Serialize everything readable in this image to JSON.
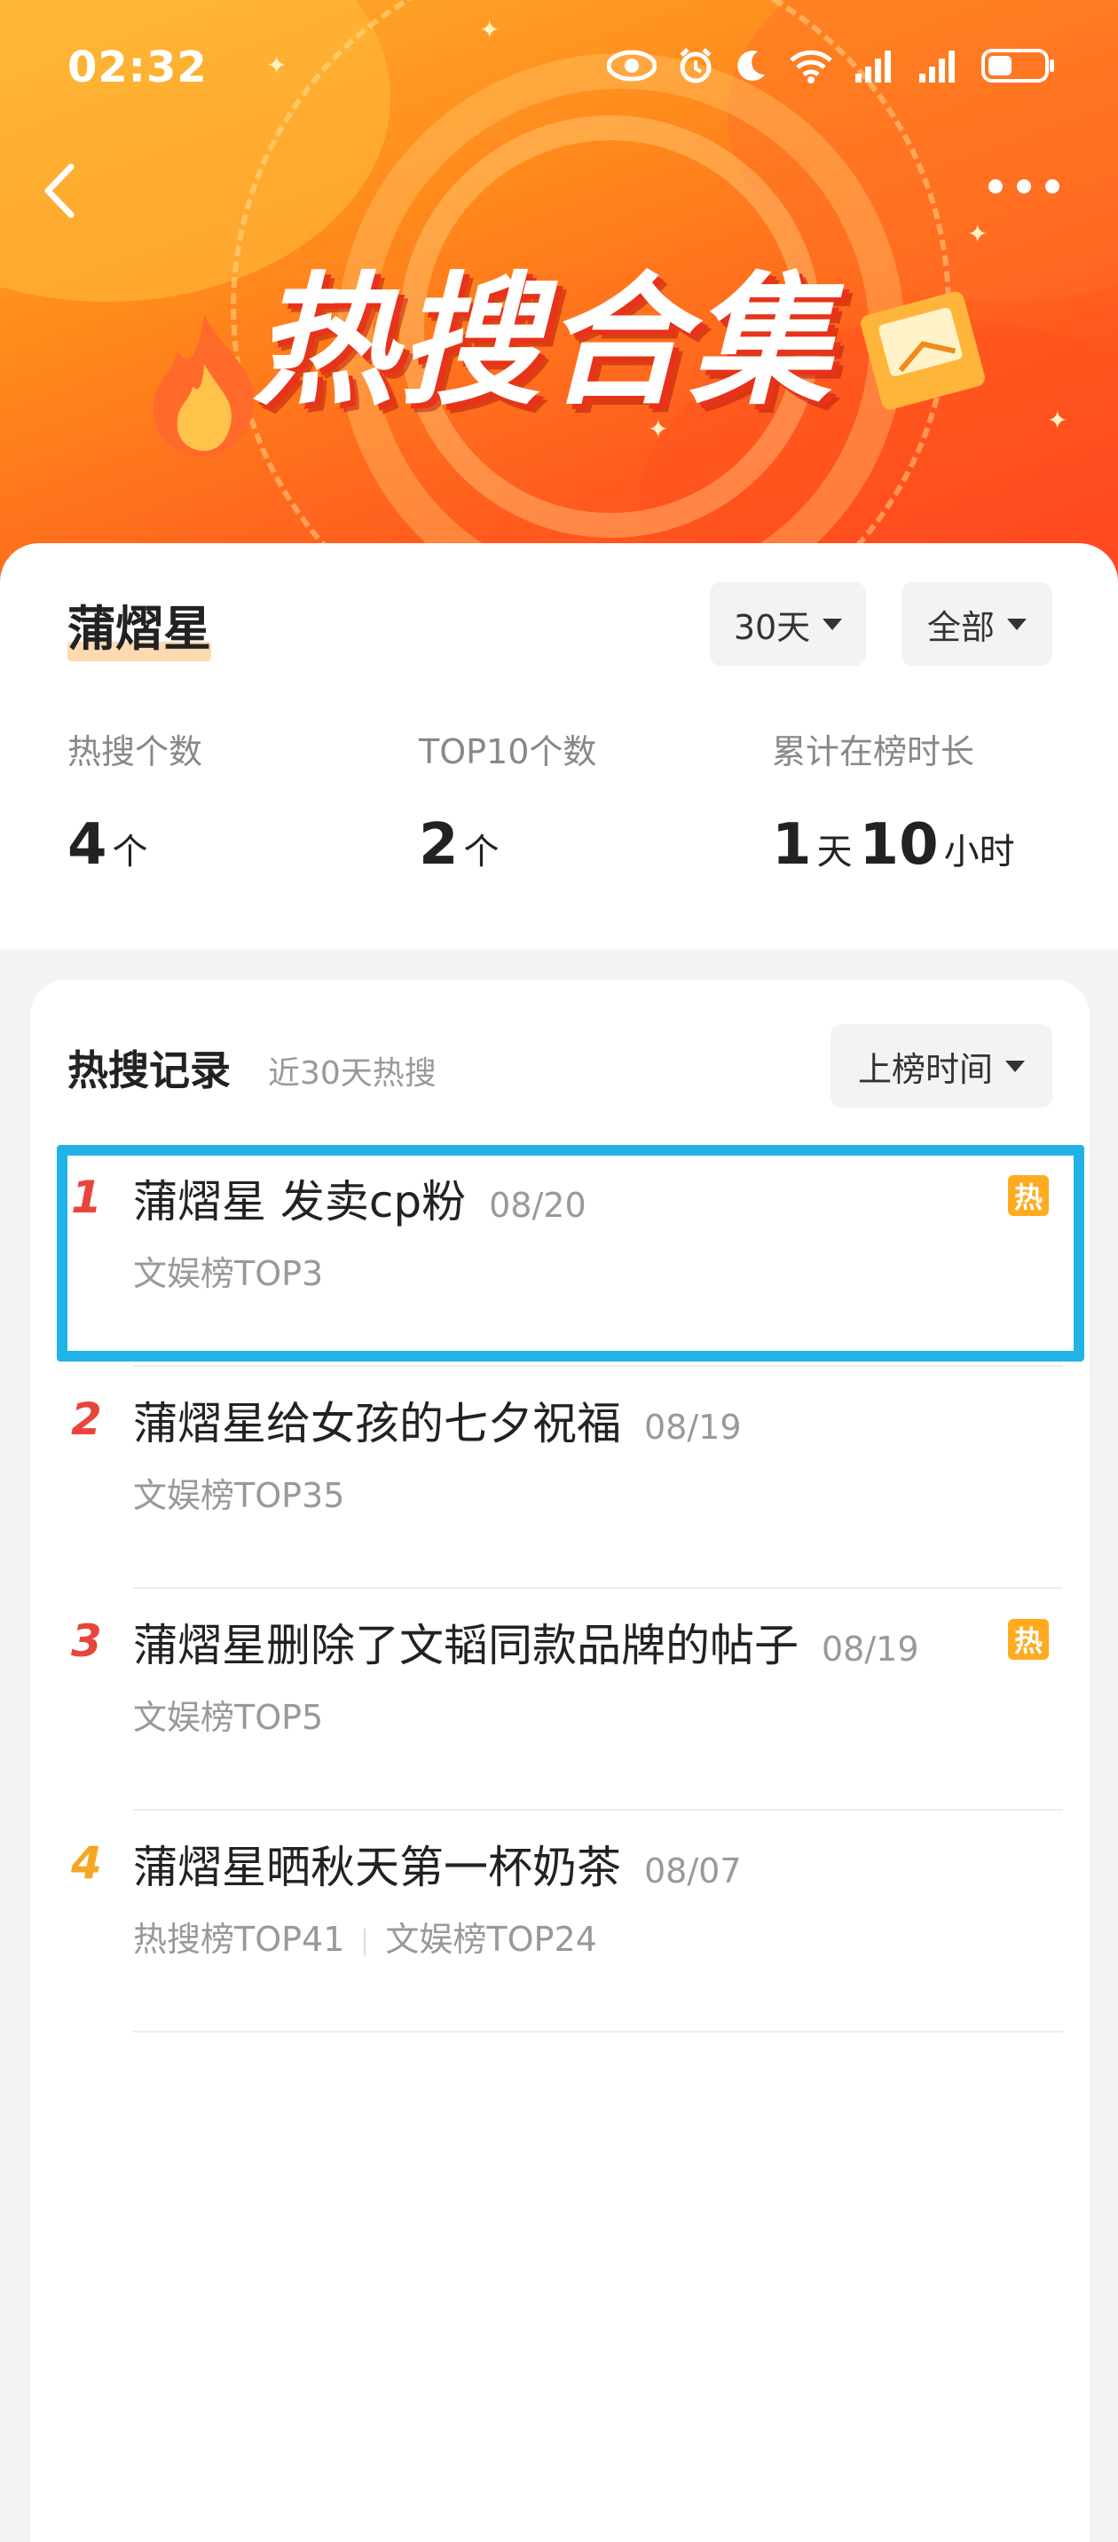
{
  "status_bar": {
    "time": "02:32"
  },
  "header": {
    "title": "热搜合集"
  },
  "summary": {
    "name": "蒲熠星",
    "filters": {
      "days": "30天",
      "scope": "全部"
    },
    "stats": [
      {
        "label": "热搜个数",
        "value": "4",
        "unit": "个"
      },
      {
        "label": "TOP10个数",
        "value": "2",
        "unit": "个"
      },
      {
        "label": "累计在榜时长",
        "days_value": "1",
        "days_unit": "天",
        "hours_value": "10",
        "hours_unit": "小时"
      }
    ]
  },
  "records": {
    "title": "热搜记录",
    "subtitle": "近30天热搜",
    "sort_label": "上榜时间",
    "items": [
      {
        "rank": "1",
        "rank_color": "#e8453c",
        "title": "蒲熠星 发卖cp粉",
        "date": "08/20",
        "sub": [
          "文娱榜TOP3"
        ],
        "hot": true,
        "hot_label": "热"
      },
      {
        "rank": "2",
        "rank_color": "#e8453c",
        "title": "蒲熠星给女孩的七夕祝福",
        "date": "08/19",
        "sub": [
          "文娱榜TOP35"
        ],
        "hot": false
      },
      {
        "rank": "3",
        "rank_color": "#e8453c",
        "title": "蒲熠星删除了文韬同款品牌的帖子",
        "date": "08/19",
        "sub": [
          "文娱榜TOP5"
        ],
        "hot": true,
        "hot_label": "热"
      },
      {
        "rank": "4",
        "rank_color": "#f5a623",
        "title": "蒲熠星晒秋天第一杯奶茶",
        "date": "08/07",
        "sub": [
          "热搜榜TOP41",
          "文娱榜TOP24"
        ],
        "hot": false
      }
    ]
  },
  "colors": {
    "accent": "#ff6a1e",
    "hot_badge": "#ffab1f",
    "highlight": "#22b3e6"
  },
  "icons": [
    "eye-icon",
    "alarm-icon",
    "moon-icon",
    "wifi-icon",
    "signal-icon",
    "signal-icon",
    "battery-icon",
    "back-chevron-icon",
    "more-icon",
    "flame-icon",
    "envelope-icon",
    "caret-down-icon"
  ]
}
